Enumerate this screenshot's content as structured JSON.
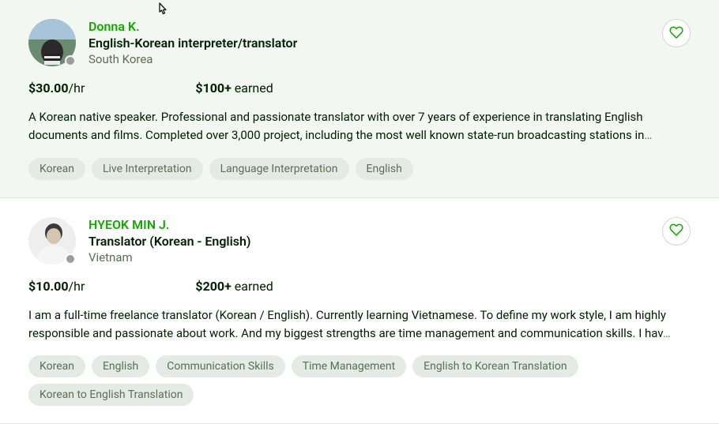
{
  "cards": [
    {
      "name": "Donna K.",
      "title": "English-Korean interpreter/translator",
      "location": "South Korea",
      "rate_amount": "$30.00",
      "rate_suffix": "/hr",
      "earned_amount": "$100+",
      "earned_suffix": " earned",
      "description": "A Korean native speaker. Professional and passionate translator with over 7 years of experience in translating English documents and films. Completed over 3,000 project, including the most well known state-run broadcasting stations in",
      "tags": [
        "Korean",
        "Live Interpretation",
        "Language Interpretation",
        "English"
      ]
    },
    {
      "name": "HYEOK MIN J.",
      "title": "Translator (Korean - English)",
      "location": "Vietnam",
      "rate_amount": "$10.00",
      "rate_suffix": "/hr",
      "earned_amount": "$200+",
      "earned_suffix": " earned",
      "description": "I am a full-time freelance translator (Korean / English). Currently learning Vietnamese. To define my work style, I am highly responsible and passionate about work. And my biggest strengths are time management and communication skills. I hav",
      "tags": [
        "Korean",
        "English",
        "Communication Skills",
        "Time Management",
        "English to Korean Translation",
        "Korean to English Translation"
      ]
    }
  ]
}
